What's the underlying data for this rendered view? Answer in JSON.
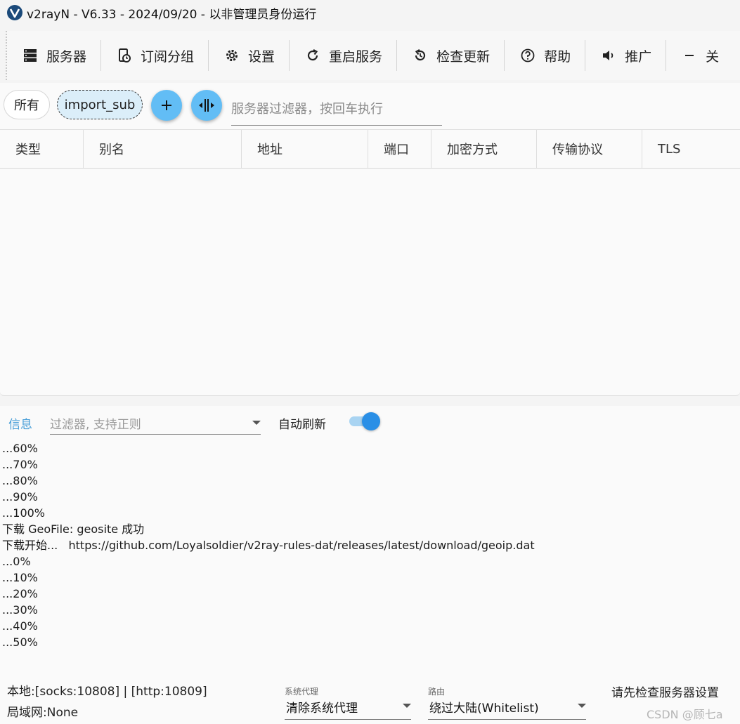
{
  "window": {
    "title": "v2rayN - V6.33 - 2024/09/20 - 以非管理员身份运行"
  },
  "toolbar": {
    "items": [
      {
        "label": "服务器",
        "icon": "server-icon"
      },
      {
        "label": "订阅分组",
        "icon": "subscription-icon"
      },
      {
        "label": "设置",
        "icon": "gear-icon"
      },
      {
        "label": "重启服务",
        "icon": "restart-icon"
      },
      {
        "label": "检查更新",
        "icon": "update-icon"
      },
      {
        "label": "帮助",
        "icon": "help-icon"
      },
      {
        "label": "推广",
        "icon": "speaker-icon"
      },
      {
        "label": "关",
        "icon": "minus-icon"
      }
    ]
  },
  "filters": {
    "all_label": "所有",
    "sub_label": "import_sub",
    "server_filter_placeholder": "服务器过滤器，按回车执行"
  },
  "grid": {
    "columns": [
      "类型",
      "别名",
      "地址",
      "端口",
      "加密方式",
      "传输协议",
      "TLS"
    ]
  },
  "log": {
    "tab_label": "信息",
    "filter_placeholder": "过滤器, 支持正则",
    "auto_refresh_label": "自动刷新",
    "auto_refresh_on": true,
    "lines": [
      "...60%",
      "...70%",
      "...80%",
      "...90%",
      "...100%",
      "下载 GeoFile: geosite 成功",
      "下载开始...   https://github.com/Loyalsoldier/v2ray-rules-dat/releases/latest/download/geoip.dat",
      "...0%",
      "...10%",
      "...20%",
      "...30%",
      "...40%",
      "...50%"
    ]
  },
  "status": {
    "local": "本地:[socks:10808] | [http:10809]",
    "lan": "局域网:None",
    "proxy_label": "系统代理",
    "proxy_value": "清除系统代理",
    "route_label": "路由",
    "route_value": "绕过大陆(Whitelist)",
    "message": "请先检查服务器设置",
    "watermark": "CSDN @顾七a"
  },
  "colors": {
    "accent": "#62bdf5",
    "toggle": "#2a8fe6",
    "tab": "#4a9fd8"
  }
}
